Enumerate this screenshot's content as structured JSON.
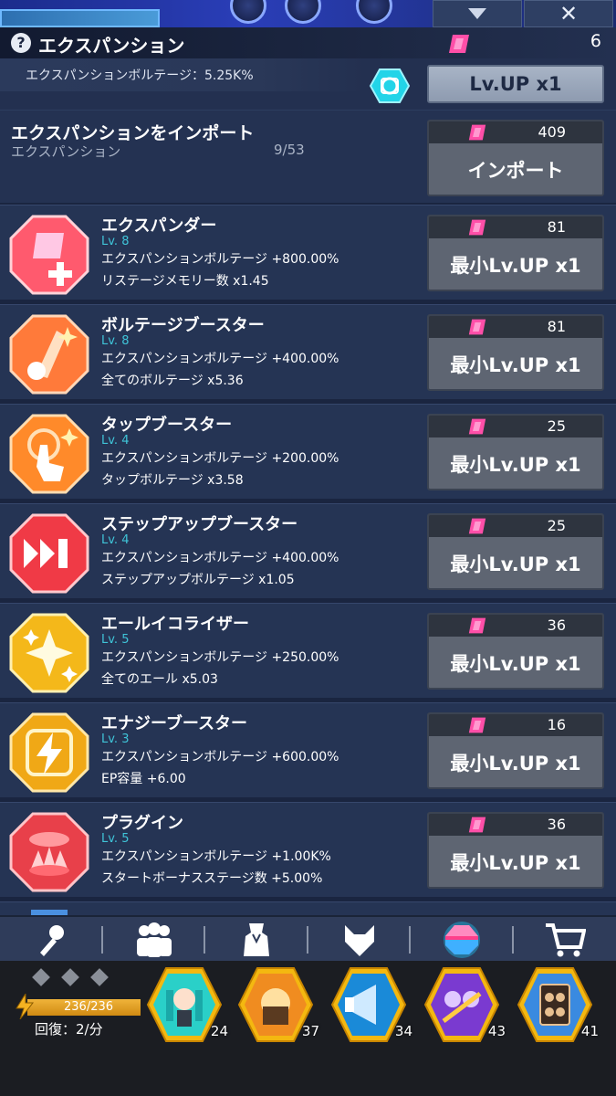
{
  "header": {
    "title": "エクスパンション",
    "currency_count": "6",
    "voltage": "エクスパンションボルテージ：5.25K%",
    "lvup_label": "Lv.UP x1"
  },
  "import": {
    "title": "エクスパンションをインポート",
    "subtitle": "エクスパンション",
    "count": "9/53",
    "cost": "409",
    "button": "インポート"
  },
  "items": [
    {
      "name": "エクスパンダー",
      "lv": "Lv. 8",
      "eff1": "エクスパンションボルテージ +800.00%",
      "eff2": "リステージメモリー数 x1.45",
      "cost": "81",
      "button": "最小Lv.UP x1",
      "icon": "expander-icon"
    },
    {
      "name": "ボルテージブースター",
      "lv": "Lv. 8",
      "eff1": "エクスパンションボルテージ +400.00%",
      "eff2": "全てのボルテージ x5.36",
      "cost": "81",
      "button": "最小Lv.UP x1",
      "icon": "voltage-booster-icon"
    },
    {
      "name": "タップブースター",
      "lv": "Lv. 4",
      "eff1": "エクスパンションボルテージ +200.00%",
      "eff2": "タップボルテージ x3.58",
      "cost": "25",
      "button": "最小Lv.UP x1",
      "icon": "tap-booster-icon"
    },
    {
      "name": "ステップアップブースター",
      "lv": "Lv. 4",
      "eff1": "エクスパンションボルテージ +400.00%",
      "eff2": "ステップアップボルテージ x1.05",
      "cost": "25",
      "button": "最小Lv.UP x1",
      "icon": "stepup-booster-icon"
    },
    {
      "name": "エールイコライザー",
      "lv": "Lv. 5",
      "eff1": "エクスパンションボルテージ +250.00%",
      "eff2": "全てのエール x5.03",
      "cost": "36",
      "button": "最小Lv.UP x1",
      "icon": "yell-equalizer-icon"
    },
    {
      "name": "エナジーブースター",
      "lv": "Lv. 3",
      "eff1": "エクスパンションボルテージ +600.00%",
      "eff2": "EP容量 +6.00",
      "cost": "16",
      "button": "最小Lv.UP x1",
      "icon": "energy-booster-icon"
    },
    {
      "name": "プラグイン",
      "lv": "Lv. 5",
      "eff1": "エクスパンションボルテージ +1.00K%",
      "eff2": "スタートボーナスステージ数 +5.00%",
      "cost": "36",
      "button": "最小Lv.UP x1",
      "icon": "plugin-icon"
    }
  ],
  "status": {
    "ep": "236/236",
    "recover": "回復：2/分"
  },
  "units": [
    "24",
    "37",
    "34",
    "43",
    "41"
  ]
}
